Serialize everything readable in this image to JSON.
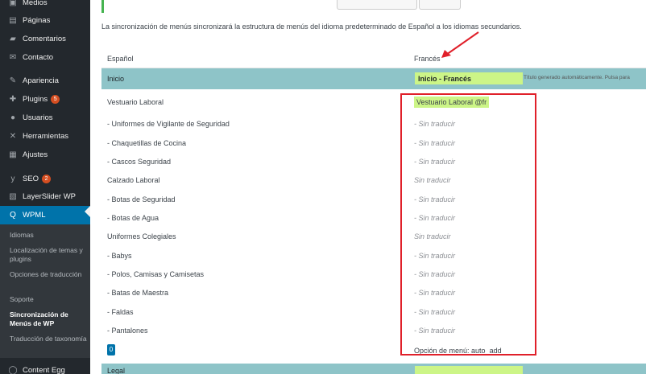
{
  "sidebar": {
    "items": [
      {
        "label": "Medios",
        "icon": "media-icon"
      },
      {
        "label": "Páginas",
        "icon": "pages-icon"
      },
      {
        "label": "Comentarios",
        "icon": "comments-icon"
      },
      {
        "label": "Contacto",
        "icon": "envelope-icon"
      },
      {
        "label": "Apariencia",
        "icon": "brush-icon"
      },
      {
        "label": "Plugins",
        "icon": "plugin-icon",
        "badge": "5"
      },
      {
        "label": "Usuarios",
        "icon": "users-icon"
      },
      {
        "label": "Herramientas",
        "icon": "wrench-icon"
      },
      {
        "label": "Ajustes",
        "icon": "settings-icon"
      },
      {
        "label": "SEO",
        "icon": "yoast-icon",
        "badge": "2"
      },
      {
        "label": "LayerSlider WP",
        "icon": "layerslider-icon"
      },
      {
        "label": "WPML",
        "icon": "wpml-icon"
      },
      {
        "label": "Content Egg",
        "icon": "egg-icon"
      }
    ],
    "submenu": [
      {
        "label": "Idiomas"
      },
      {
        "label": "Localización de temas y plugins"
      },
      {
        "label": "Opciones de traducción"
      },
      {
        "label": "Soporte"
      },
      {
        "label": "Sincronización de Menús de WP"
      },
      {
        "label": "Traducción de taxonomía"
      }
    ]
  },
  "main": {
    "notice": "La sincronización de menús sincronizará la estructura de menús del idioma predeterminado de Español a los idiomas secundarios.",
    "col_es": "Español",
    "col_fr": "Francés",
    "menu": {
      "name_es": "Inicio",
      "name_fr": "Inicio - Francés",
      "note": "Título generado automáticamente. Pulsa para"
    },
    "items": [
      {
        "es": "Vestuario Laboral",
        "fr": "Vestuario Laboral @fr"
      },
      {
        "es": "- Uniformes de Vigilante de Seguridad",
        "fr": "- Sin traducir"
      },
      {
        "es": "- Chaquetillas de Cocina",
        "fr": "- Sin traducir"
      },
      {
        "es": "- Cascos Seguridad",
        "fr": "- Sin traducir"
      },
      {
        "es": "Calzado Laboral",
        "fr": "Sin traducir"
      },
      {
        "es": "- Botas de Seguridad",
        "fr": "- Sin traducir"
      },
      {
        "es": "- Botas de Agua",
        "fr": "- Sin traducir"
      },
      {
        "es": "Uniformes Colegiales",
        "fr": "Sin traducir"
      },
      {
        "es": "- Babys",
        "fr": "- Sin traducir"
      },
      {
        "es": "- Polos, Camisas y Camisetas",
        "fr": "- Sin traducir"
      },
      {
        "es": "- Batas de Maestra",
        "fr": "- Sin traducir"
      },
      {
        "es": "- Faldas",
        "fr": "- Sin traducir"
      },
      {
        "es": "- Pantalones",
        "fr": "- Sin traducir"
      }
    ],
    "option_count": "0",
    "option_text": "Opción de menú: auto_add",
    "next_menu_es": "Legal"
  },
  "colors": {
    "sidebar_bg": "#23282d",
    "active": "#0073aa",
    "menu_row": "#8ec4c8",
    "new_highlight": "#ccf587",
    "annotation": "#e0202a"
  }
}
